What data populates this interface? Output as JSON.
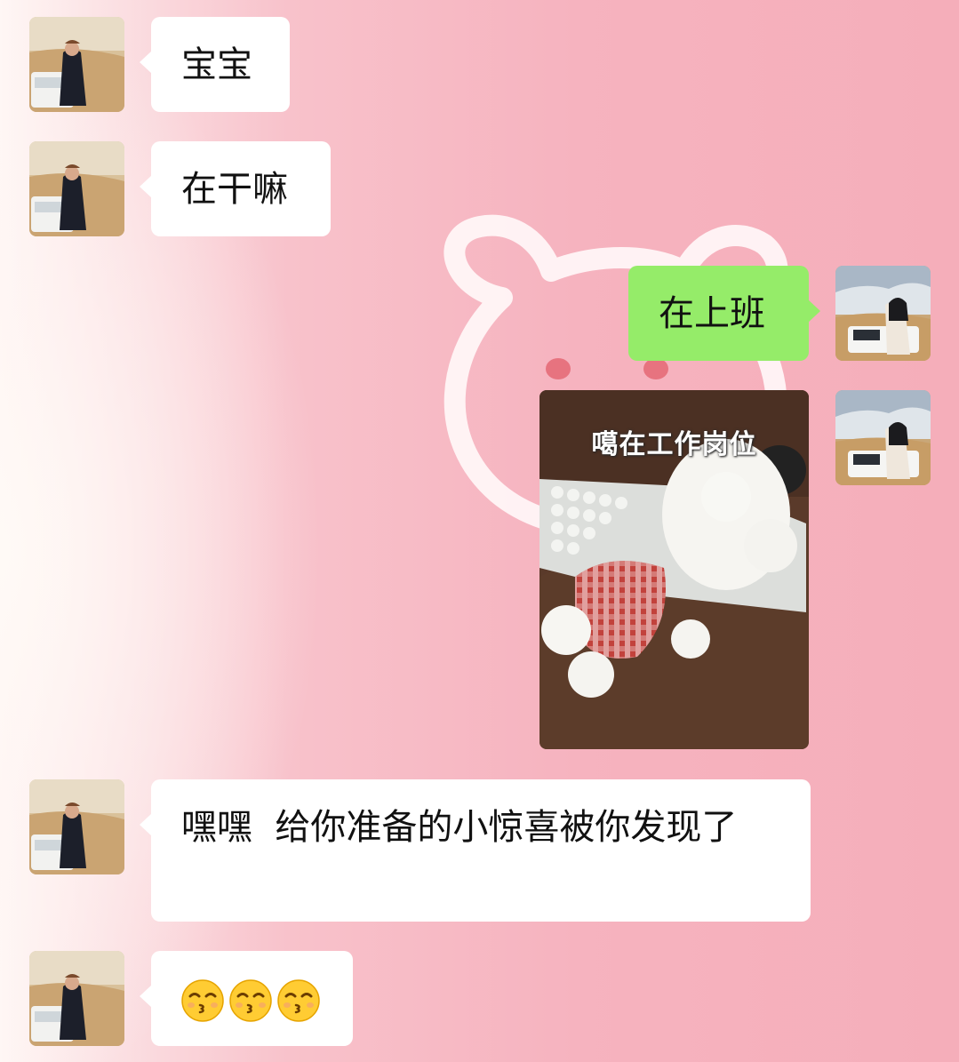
{
  "messages": [
    {
      "side": "left",
      "text": "宝宝"
    },
    {
      "side": "left",
      "text": "在干嘛"
    },
    {
      "side": "right",
      "text": "在上班"
    },
    {
      "side": "right",
      "image": true,
      "caption": "噶在工作岗位"
    },
    {
      "side": "left",
      "text": "嘿嘿  给你准备的小惊喜被你发现了"
    },
    {
      "side": "left",
      "emoji": [
        "kissing-face-with-smiling-eyes",
        "kissing-face-with-smiling-eyes",
        "kissing-face-with-smiling-eyes"
      ]
    }
  ],
  "colors": {
    "incoming_bubble": "#ffffff",
    "outgoing_bubble": "#95ec69",
    "background_pink": "#f6b3bf"
  }
}
